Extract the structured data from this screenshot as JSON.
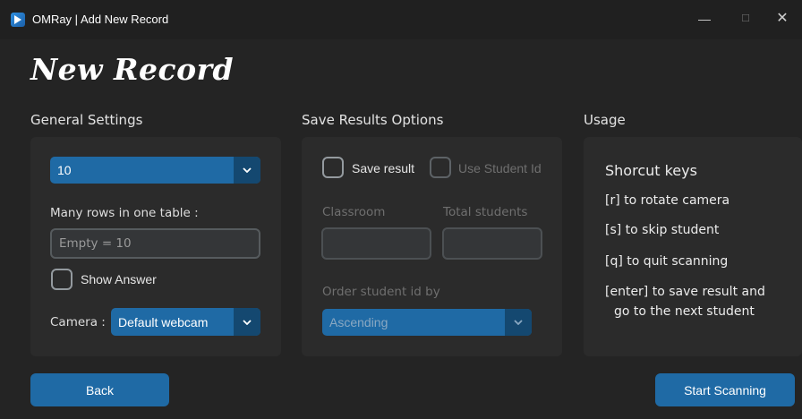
{
  "window": {
    "title": "OMRay | Add New Record",
    "minimize": "—",
    "maximize": "☐",
    "close": "✕"
  },
  "page_title": "New Record",
  "general": {
    "section_title": "General Settings",
    "rows_select_value": "10",
    "rows_label": "Many rows in one table :",
    "rows_placeholder": "Empty = 10",
    "show_answer_label": "Show Answer",
    "camera_label": "Camera :",
    "camera_value": "Default webcam"
  },
  "save": {
    "section_title": "Save Results Options",
    "save_result_label": "Save result",
    "use_student_id_label": "Use Student Id",
    "classroom_label": "Classroom",
    "total_students_label": "Total students",
    "order_label": "Order student id by",
    "order_value": "Ascending"
  },
  "usage": {
    "section_title": "Usage",
    "heading": "Shorcut keys",
    "lines": [
      "[r] to rotate camera",
      "[s] to skip student",
      "[q] to quit scanning",
      "[enter] to save result and",
      "go to the next student"
    ]
  },
  "buttons": {
    "back": "Back",
    "start": "Start Scanning"
  },
  "colors": {
    "background": "#242424",
    "panel": "#2b2b2b",
    "accent": "#1f6aa5",
    "accent_dark": "#144870"
  }
}
